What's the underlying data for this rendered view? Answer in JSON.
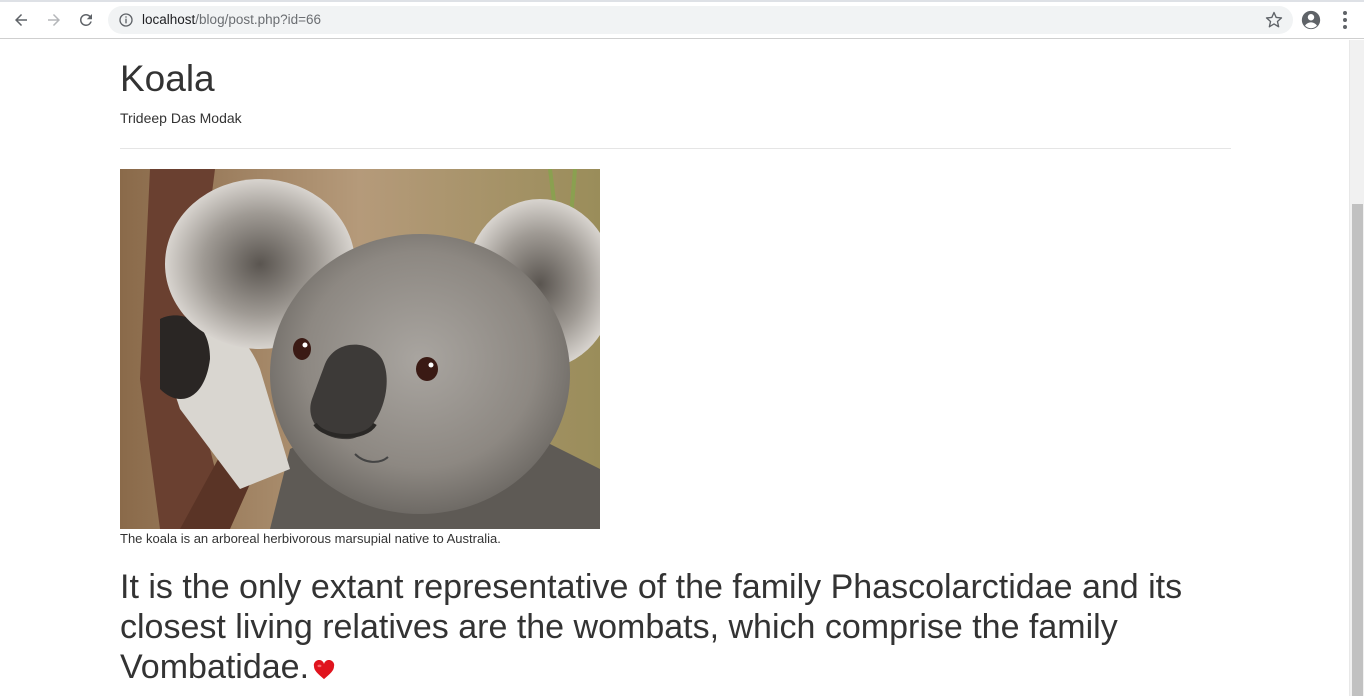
{
  "browser": {
    "url_host": "localhost",
    "url_path": "/blog/post.php?id=66",
    "icons": {
      "back": "back-arrow-icon",
      "forward": "forward-arrow-icon",
      "reload": "reload-icon",
      "site_info": "info-icon",
      "bookmark": "star-icon",
      "profile": "account-circle-icon",
      "menu": "kebab-menu-icon"
    }
  },
  "post": {
    "title": "Koala",
    "author": "Trideep Das Modak",
    "image_caption": "The koala is an arboreal herbivorous marsupial native to Australia.",
    "body": "It is the only extant representative of the family Phascolarctidae and its closest living relatives are the wombats, which comprise the family Vombatidae.",
    "emoji_icon": "red-heart-icon"
  },
  "colors": {
    "text": "#333333",
    "heart": "#e0141e"
  }
}
